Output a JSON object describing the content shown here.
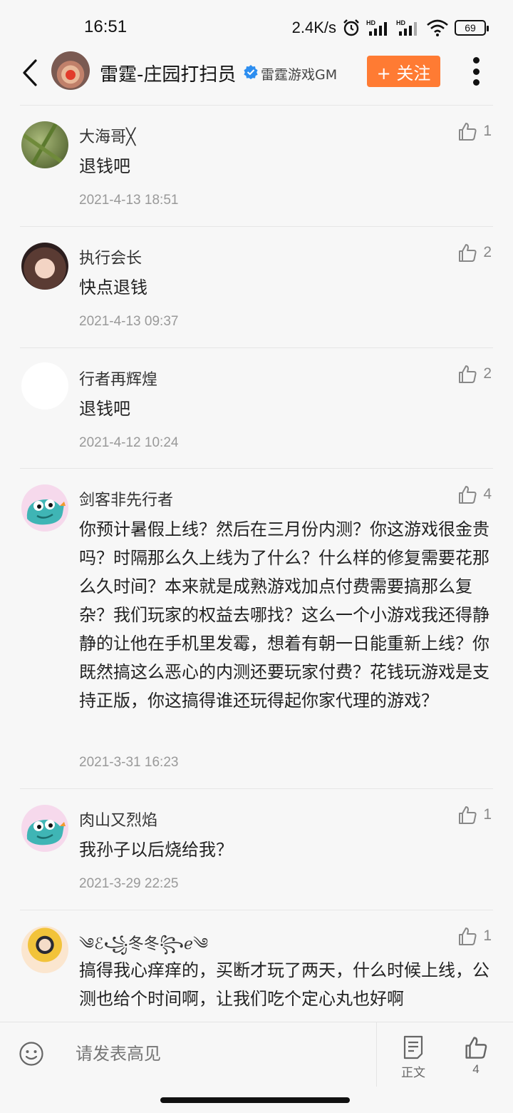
{
  "status_bar": {
    "time": "16:51",
    "net_speed": "2.4K/s",
    "battery": "69",
    "icons": [
      "alarm-icon",
      "signal-hd-icon",
      "signal-hd-icon",
      "wifi-icon",
      "battery-icon"
    ]
  },
  "header": {
    "name": "雷霆-庄园打扫员",
    "subtitle": "雷霆游戏GM",
    "follow_label": "+ 关注",
    "accent_color": "#ff7b33"
  },
  "comments": [
    {
      "user": "大海哥╳",
      "text": "退钱吧",
      "time": "2021-4-13 18:51",
      "likes": "1"
    },
    {
      "user": "执行会长",
      "text": "快点退钱",
      "time": "2021-4-13 09:37",
      "likes": "2"
    },
    {
      "user": "行者再辉煌",
      "text": "退钱吧",
      "time": "2021-4-12 10:24",
      "likes": "2"
    },
    {
      "user": "剑客非先行者",
      "text": "你预计暑假上线？然后在三月份内测？你这游戏很金贵吗？时隔那么久上线为了什么？什么样的修复需要花那么久时间？本来就是成熟游戏加点付费需要搞那么复杂？我们玩家的权益去哪找？这么一个小游戏我还得静静的让他在手机里发霉，想着有朝一日能重新上线？你既然搞这么恶心的内测还要玩家付费？花钱玩游戏是支持正版，你这搞得谁还玩得起你家代理的游戏？",
      "time": "2021-3-31 16:23",
      "likes": "4"
    },
    {
      "user": "肉山又烈焰",
      "text": "我孙子以后烧给我？",
      "time": "2021-3-29 22:25",
      "likes": "1"
    },
    {
      "user": "༄ℰ꧁冬冬꧂ℯ༄",
      "text": "搞得我心痒痒的，买断才玩了两天，什么时候上线，公测也给个时间啊，让我们吃个定心丸也好啊",
      "time": "",
      "likes": "1"
    }
  ],
  "bottom_bar": {
    "input_placeholder": "请发表高见",
    "body_label": "正文",
    "like_count": "4"
  }
}
